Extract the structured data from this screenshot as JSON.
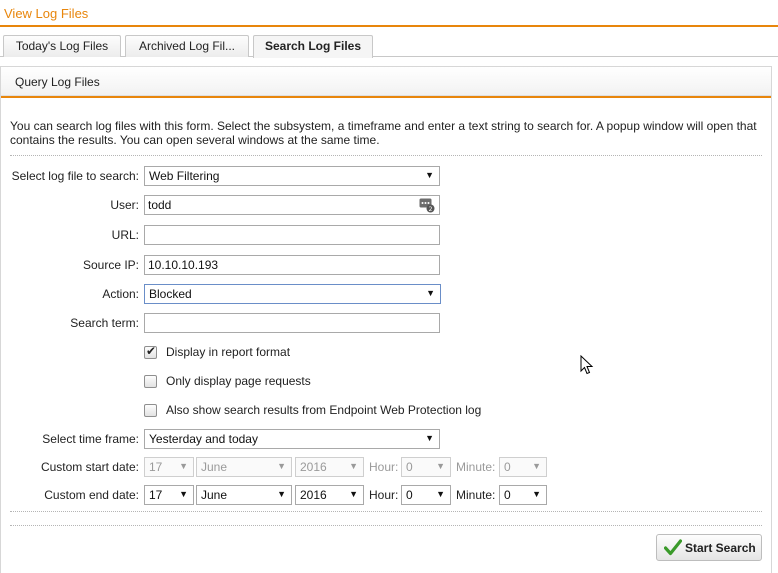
{
  "page": {
    "title": "View Log Files"
  },
  "tabs": [
    {
      "label": "Today's Log Files",
      "active": false
    },
    {
      "label": "Archived Log Fil...",
      "active": false
    },
    {
      "label": "Search Log Files",
      "active": true
    }
  ],
  "panel": {
    "title": "Query Log Files"
  },
  "intro": "You can search log files with this form. Select the subsystem, a timeframe and enter a text string to search for. A popup window will open that contains the results. You can open several windows at the same time.",
  "form": {
    "log_file": {
      "label": "Select log file to search:",
      "value": "Web Filtering"
    },
    "user": {
      "label": "User:",
      "value": "todd"
    },
    "url": {
      "label": "URL:",
      "value": ""
    },
    "source_ip": {
      "label": "Source IP:",
      "value": "10.10.10.193"
    },
    "action": {
      "label": "Action:",
      "value": "Blocked"
    },
    "search_term": {
      "label": "Search term:",
      "value": ""
    },
    "report_format": {
      "label": "Display in report format",
      "checked": true
    },
    "page_requests": {
      "label": "Only display page requests",
      "checked": false
    },
    "endpoint": {
      "label": "Also show search results from Endpoint Web Protection log",
      "checked": false
    },
    "time_frame": {
      "label": "Select time frame:",
      "value": "Yesterday and today"
    },
    "start": {
      "label": "Custom start date:",
      "day": "17",
      "month": "June",
      "year": "2016",
      "hour_label": "Hour:",
      "hour": "0",
      "minute_label": "Minute:",
      "minute": "0",
      "disabled": true
    },
    "end": {
      "label": "Custom end date:",
      "day": "17",
      "month": "June",
      "year": "2016",
      "hour_label": "Hour:",
      "hour": "0",
      "minute_label": "Minute:",
      "minute": "0",
      "disabled": false
    }
  },
  "buttons": {
    "start_search": "Start Search"
  },
  "colors": {
    "accent": "#e8860c",
    "check_green": "#3a9a2a"
  }
}
